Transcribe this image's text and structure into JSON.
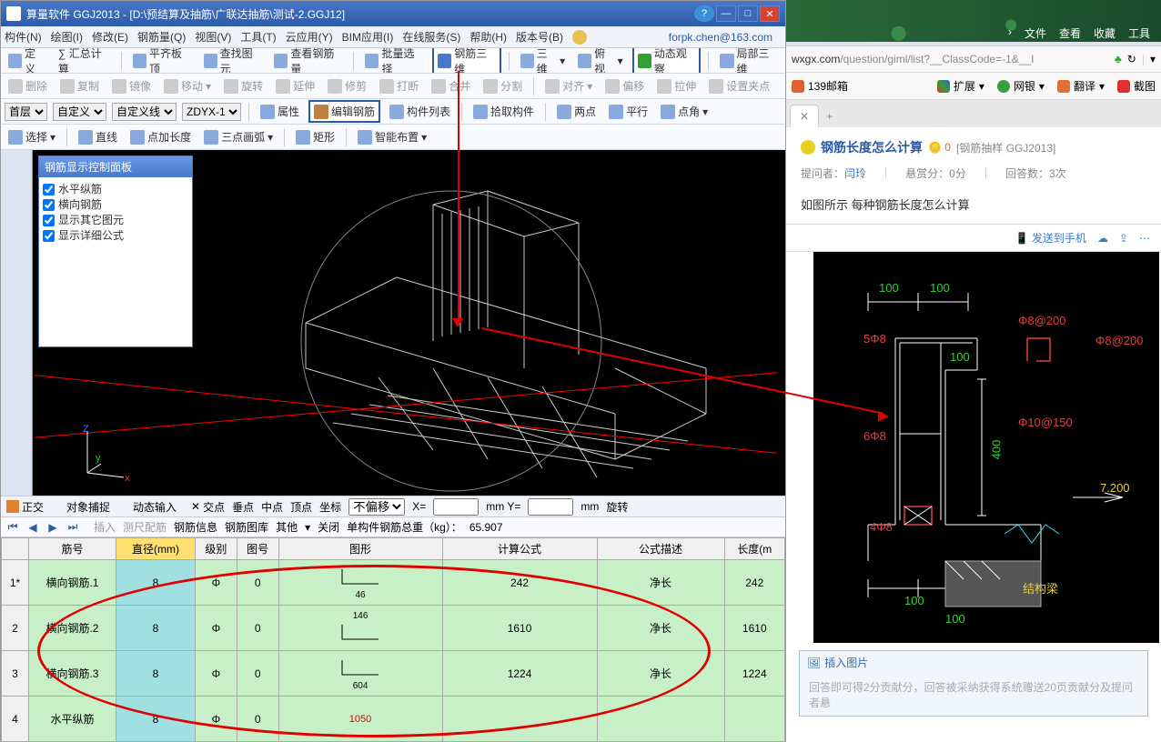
{
  "titlebar": {
    "title": "算量软件 GGJ2013 - [D:\\预结算及抽筋\\广联达抽筋\\测试-2.GGJ12]"
  },
  "menubar": {
    "items": [
      "构件(N)",
      "绘图(I)",
      "修改(E)",
      "钢筋量(Q)",
      "视图(V)",
      "工具(T)",
      "云应用(Y)",
      "BIM应用(I)",
      "在线服务(S)",
      "帮助(H)",
      "版本号(B)"
    ],
    "user": "forpk.chen@163.com"
  },
  "toolbar1": {
    "define": "定义",
    "sum": "∑ 汇总计算",
    "flat": "平齐板顶",
    "findcomp": "查找图元",
    "viewrebar": "查看钢筋量",
    "batchsel": "批量选择",
    "rebar3d": "钢筋三维",
    "threed": "三维",
    "persp": "俯视",
    "dynview": "动态观察",
    "part3d": "局部三维"
  },
  "toolbar2": {
    "del": "删除",
    "copy": "复制",
    "mirror": "镜像",
    "move": "移动",
    "rotate": "旋转",
    "extend": "延伸",
    "trim": "修剪",
    "break": "打断",
    "merge": "合并",
    "split": "分割",
    "align": "对齐",
    "offset": "偏移",
    "stretch": "拉伸",
    "setpt": "设置夹点"
  },
  "toolbar3": {
    "floor": "首层",
    "custom": "自定义",
    "customline": "自定义线",
    "code": "ZDYX-1",
    "prop": "属性",
    "editrebar": "编辑钢筋",
    "complist": "构件列表",
    "pick": "拾取构件",
    "twopt": "两点",
    "parallel": "平行",
    "ptangle": "点角"
  },
  "toolbar4": {
    "sel": "选择",
    "line": "直线",
    "ptlen": "点加长度",
    "threeptarc": "三点画弧",
    "rect": "矩形",
    "smart": "智能布置"
  },
  "control_panel": {
    "title": "钢筋显示控制面板",
    "opts": [
      "水平纵筋",
      "横向钢筋",
      "显示其它图元",
      "显示详细公式"
    ]
  },
  "snapbar": {
    "ortho": "正交",
    "objsnap": "对象捕捉",
    "dyninput": "动态输入",
    "cross": "交点",
    "perp": "垂点",
    "mid": "中点",
    "vertex": "顶点",
    "coord": "坐标",
    "nooffset": "不偏移",
    "x": "X=",
    "y": "mm Y=",
    "mm": "mm",
    "rot": "旋转"
  },
  "playbar": {
    "insert": "插入",
    "measure": "测尺配筋",
    "rebarinfo": "钢筋信息",
    "rebarlib": "钢筋图库",
    "other": "其他",
    "close": "关闭",
    "weight_label": "单构件钢筋总重（kg）：",
    "weight": "65.907"
  },
  "table": {
    "headers": [
      "",
      "筋号",
      "直径(mm)",
      "级别",
      "图号",
      "图形",
      "计算公式",
      "公式描述",
      "长度(m"
    ],
    "rows": [
      {
        "n": "1*",
        "name": "横向钢筋.1",
        "dia": "8",
        "lvl": "Φ",
        "fig": "0",
        "shape_top": "",
        "shape_bot": "46",
        "calc": "242",
        "desc": "净长",
        "len": "242"
      },
      {
        "n": "2",
        "name": "横向钢筋.2",
        "dia": "8",
        "lvl": "Φ",
        "fig": "0",
        "shape_top": "146",
        "shape_bot": "",
        "calc": "1610",
        "desc": "净长",
        "len": "1610"
      },
      {
        "n": "3",
        "name": "横向钢筋.3",
        "dia": "8",
        "lvl": "Φ",
        "fig": "0",
        "shape_top": "",
        "shape_bot": "604",
        "calc": "1224",
        "desc": "净长",
        "len": "1224"
      },
      {
        "n": "4",
        "name": "水平纵筋",
        "dia": "8",
        "lvl": "Φ",
        "fig": "0",
        "shape_top": "1050",
        "shape_bot": "",
        "calc": "",
        "desc": "",
        "len": ""
      }
    ]
  },
  "right": {
    "menu": [
      "文件",
      "查看",
      "收藏",
      "工具"
    ],
    "url_host": "wxgx.com",
    "url_path": "/question/giml/list?__ClassCode=-1&__I",
    "ext": {
      "mail": "139邮箱",
      "expand": "扩展",
      "bank": "网银",
      "trans": "翻译",
      "shot": "截图"
    },
    "tab_new": "+",
    "question": {
      "title": "钢筋长度怎么计算",
      "reward": "0",
      "tag": "[钢筋抽样 GGJ2013]",
      "asker_lbl": "提问者：",
      "asker": "闫玲",
      "bounty": "悬赏分：0分",
      "answers": "回答数：3次",
      "desc": "如图所示 每种钢筋长度怎么计算",
      "send": "发送到手机"
    },
    "cad": {
      "d100a": "100",
      "d100b": "100",
      "fi8_200": "Φ8@200",
      "fi8_200b": "Φ8@200",
      "n5fi8": "5Φ8",
      "d100c": "100",
      "n6fi8": "6Φ8",
      "fi10_150": "Φ10@150",
      "d400": "400",
      "lv7200": "7.200",
      "n4fi8": "4Φ8",
      "d100d": "100",
      "d100e": "100",
      "beam": "结构梁"
    },
    "insert": {
      "title": "插入图片",
      "hint": "回答即可得2分贡献分，回答被采纳获得系统赠送20页贡献分及提问者悬"
    }
  }
}
